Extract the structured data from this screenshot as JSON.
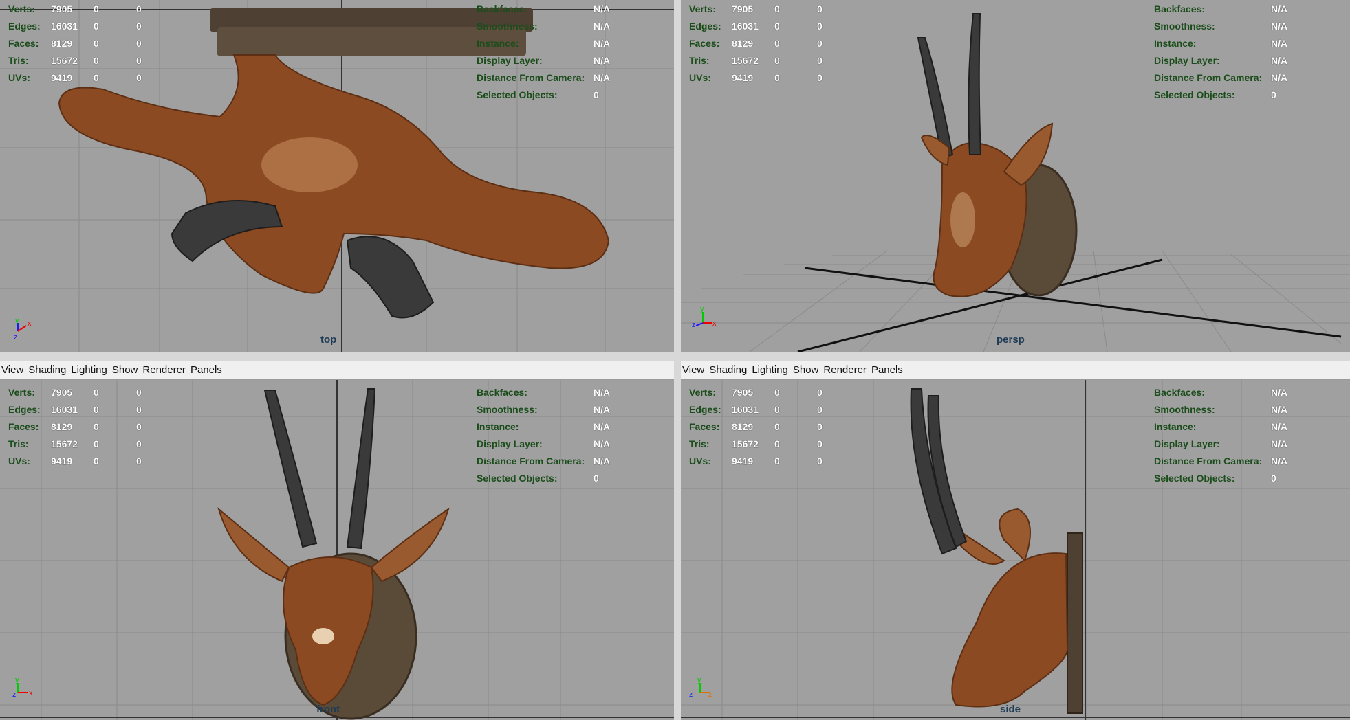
{
  "menu": [
    "View",
    "Shading",
    "Lighting",
    "Show",
    "Renderer",
    "Panels"
  ],
  "stats": {
    "rows": [
      {
        "label": "Verts:",
        "a": "7905",
        "b": "0",
        "c": "0"
      },
      {
        "label": "Edges:",
        "a": "16031",
        "b": "0",
        "c": "0"
      },
      {
        "label": "Faces:",
        "a": "8129",
        "b": "0",
        "c": "0"
      },
      {
        "label": "Tris:",
        "a": "15672",
        "b": "0",
        "c": "0"
      },
      {
        "label": "UVs:",
        "a": "9419",
        "b": "0",
        "c": "0"
      }
    ],
    "right": [
      {
        "label": "Backfaces:",
        "value": "N/A"
      },
      {
        "label": "Smoothness:",
        "value": "N/A"
      },
      {
        "label": "Instance:",
        "value": "N/A"
      },
      {
        "label": "Display Layer:",
        "value": "N/A"
      },
      {
        "label": "Distance From Camera:",
        "value": "N/A"
      },
      {
        "label": "Selected Objects:",
        "value": "0"
      }
    ]
  },
  "viewports": {
    "top": {
      "camera": "top"
    },
    "persp": {
      "camera": "persp"
    },
    "front": {
      "camera": "front"
    },
    "side": {
      "camera": "side"
    }
  },
  "colors": {
    "viewport_bg": "#a0a0a0",
    "grid": "#8a8a8a",
    "fur": "#8b4a22",
    "horn": "#3a3a3a",
    "plaque": "#5a4a38"
  },
  "icons": [
    "axis-gizmo-icon"
  ]
}
